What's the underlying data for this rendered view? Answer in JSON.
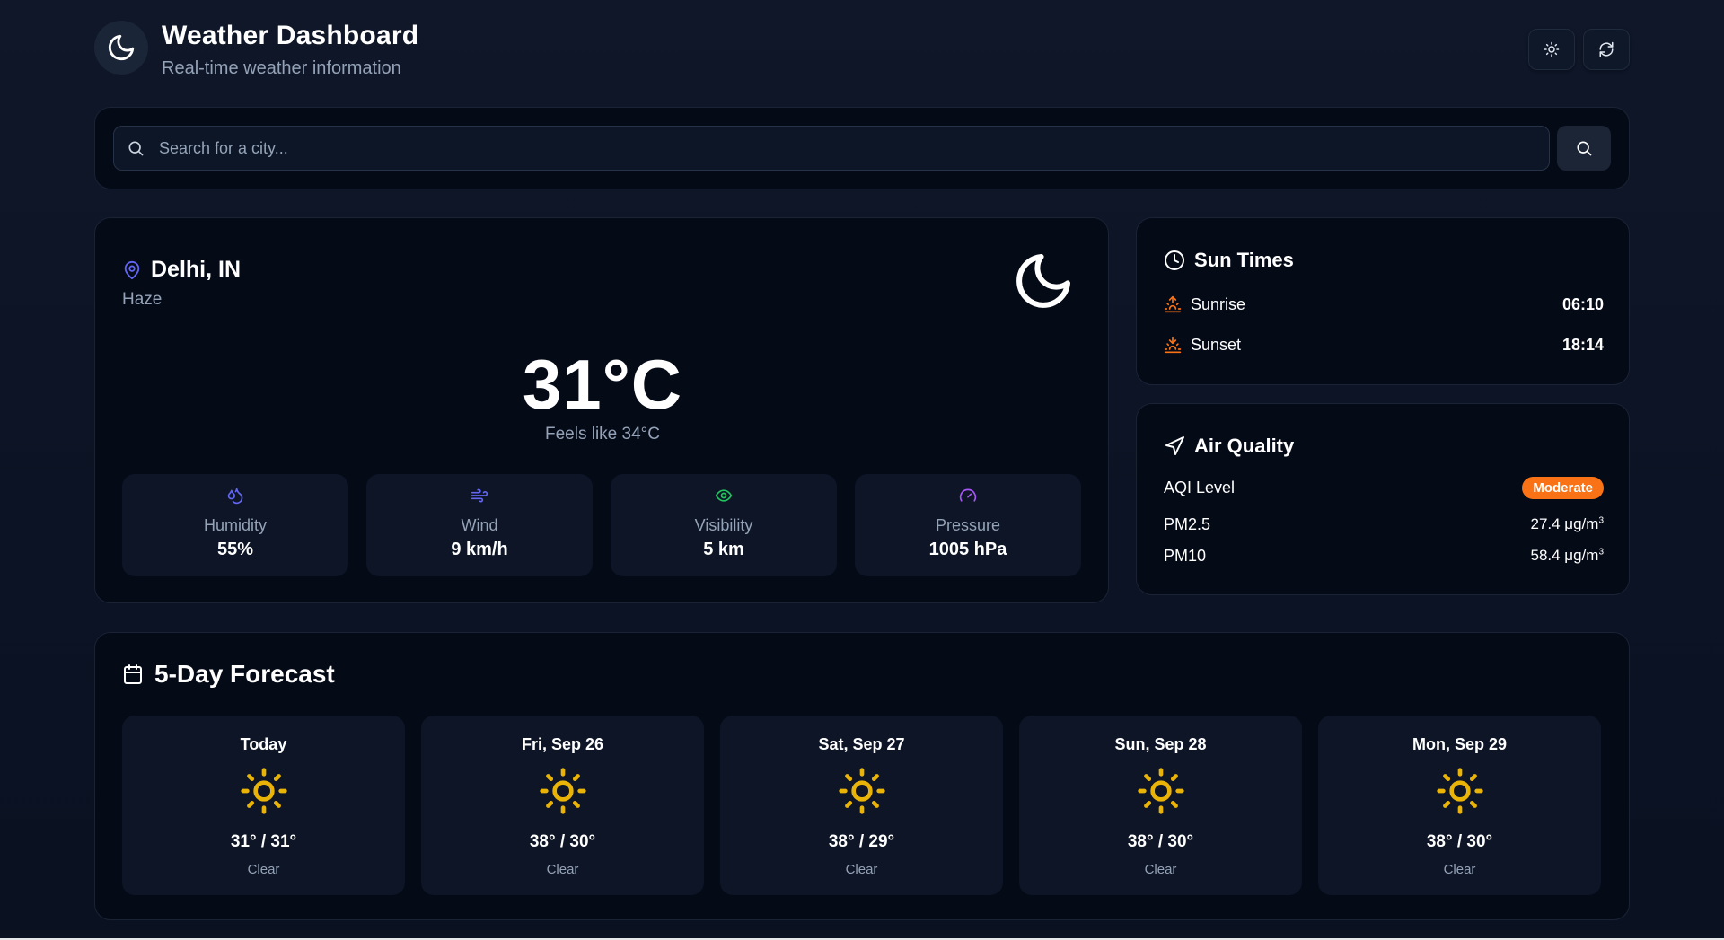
{
  "header": {
    "title": "Weather Dashboard",
    "subtitle": "Real-time weather information"
  },
  "search": {
    "placeholder": "Search for a city..."
  },
  "current": {
    "location": "Delhi, IN",
    "condition": "Haze",
    "temperature": "31°C",
    "feels_like": "Feels like 34°C",
    "stats": [
      {
        "label": "Humidity",
        "value": "55%",
        "icon": "droplets-icon",
        "color": "#6366f1"
      },
      {
        "label": "Wind",
        "value": "9 km/h",
        "icon": "wind-icon",
        "color": "#6366f1"
      },
      {
        "label": "Visibility",
        "value": "5 km",
        "icon": "eye-icon",
        "color": "#22c55e"
      },
      {
        "label": "Pressure",
        "value": "1005 hPa",
        "icon": "gauge-icon",
        "color": "#a855f7"
      }
    ]
  },
  "sun_times": {
    "title": "Sun Times",
    "sunrise_label": "Sunrise",
    "sunrise": "06:10",
    "sunset_label": "Sunset",
    "sunset": "18:14",
    "accent": "#f97316"
  },
  "air_quality": {
    "title": "Air Quality",
    "aqi_label": "AQI Level",
    "aqi_value": "Moderate",
    "pm25_label": "PM2.5",
    "pm25_value": "27.4 μg/m",
    "pm10_label": "PM10",
    "pm10_value": "58.4 μg/m",
    "unit_superscript": "3",
    "badge_color": "#f97316"
  },
  "forecast": {
    "title": "5-Day Forecast",
    "days": [
      {
        "day": "Today",
        "temps": "31° / 31°",
        "condition": "Clear",
        "icon": "sun-icon"
      },
      {
        "day": "Fri, Sep 26",
        "temps": "38° / 30°",
        "condition": "Clear",
        "icon": "sun-icon"
      },
      {
        "day": "Sat, Sep 27",
        "temps": "38° / 29°",
        "condition": "Clear",
        "icon": "sun-icon"
      },
      {
        "day": "Sun, Sep 28",
        "temps": "38° / 30°",
        "condition": "Clear",
        "icon": "sun-icon"
      },
      {
        "day": "Mon, Sep 29",
        "temps": "38° / 30°",
        "condition": "Clear",
        "icon": "sun-icon"
      }
    ]
  },
  "colors": {
    "background": "#0b1324",
    "card": "#050a17",
    "tile": "#0d1526",
    "sun_yellow": "#eab308",
    "location_pin": "#6366f1"
  }
}
